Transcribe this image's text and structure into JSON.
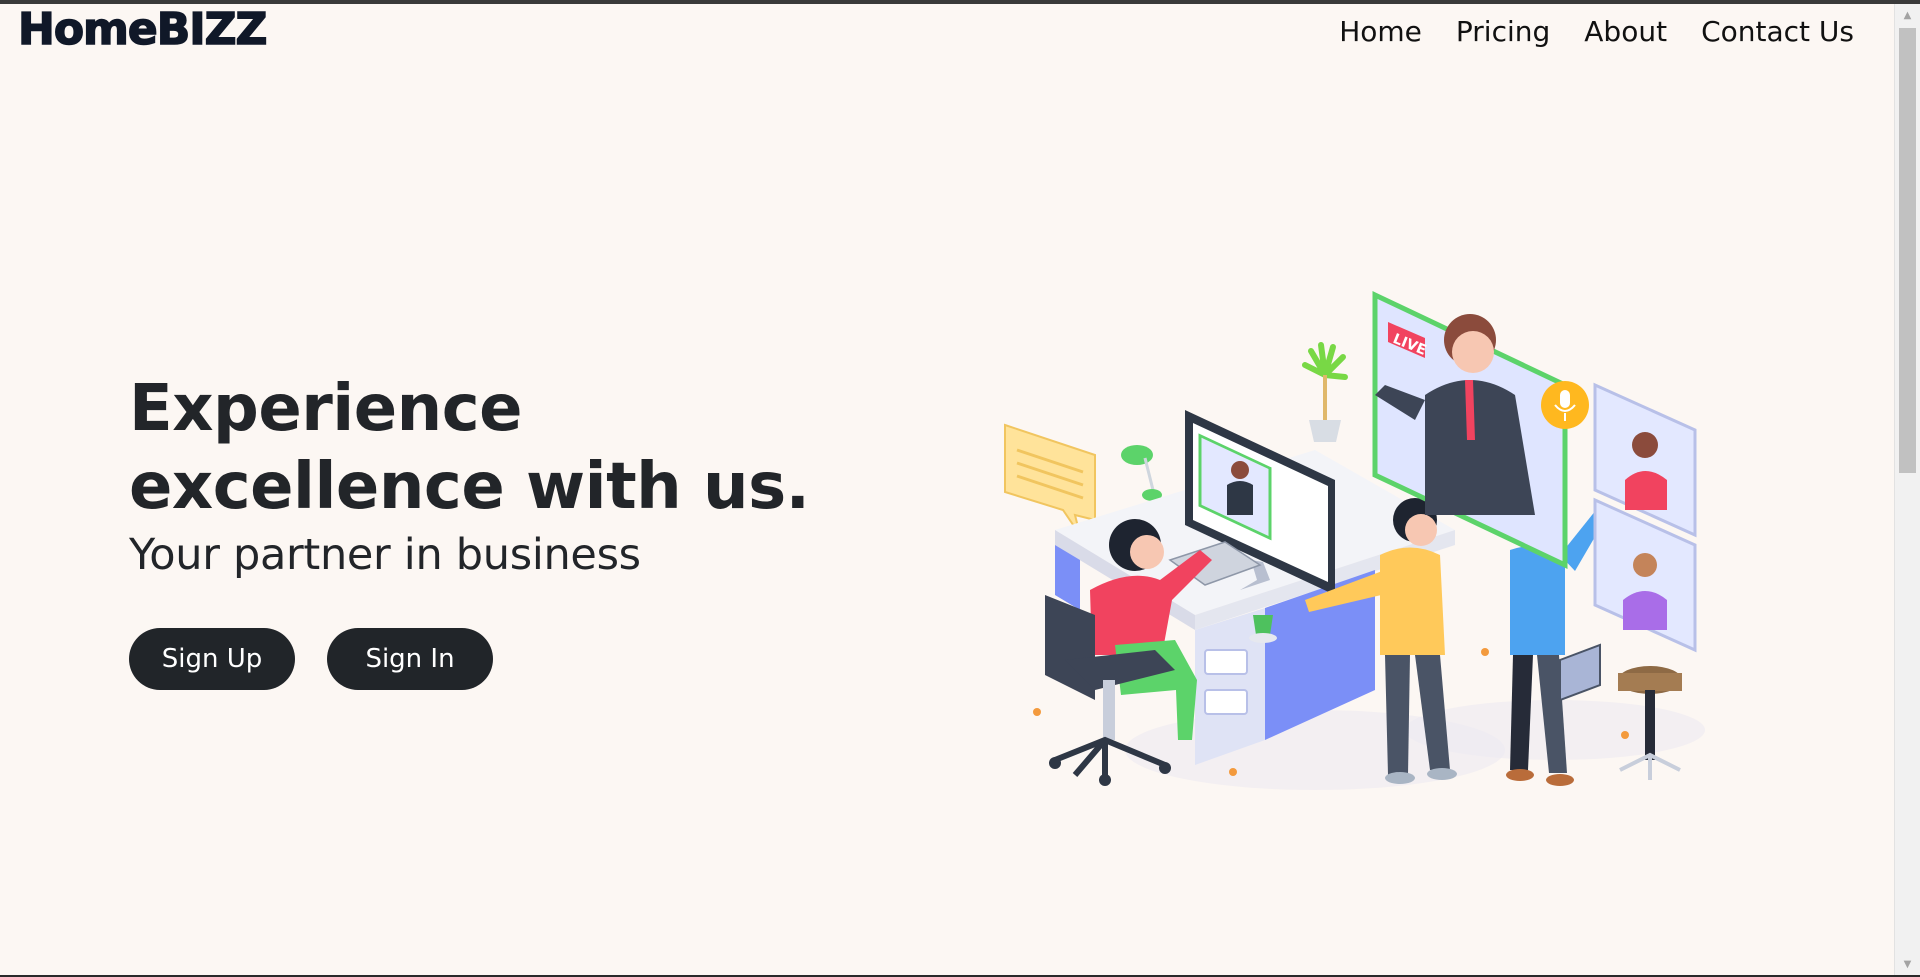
{
  "brand": {
    "name": "HomeBIZZ"
  },
  "nav": {
    "items": [
      "Home",
      "Pricing",
      "About",
      "Contact Us"
    ]
  },
  "hero": {
    "title": "Experience excellence with us.",
    "subtitle": "Your partner in business",
    "signup_label": "Sign Up",
    "signin_label": "Sign In"
  },
  "illustration": {
    "live_label": "LIVE"
  },
  "colors": {
    "background": "#fcf7f3",
    "button": "#212529",
    "text": "#222529"
  },
  "icons": {
    "scroll_up": "chevron-up-icon",
    "scroll_down": "chevron-down-icon"
  }
}
